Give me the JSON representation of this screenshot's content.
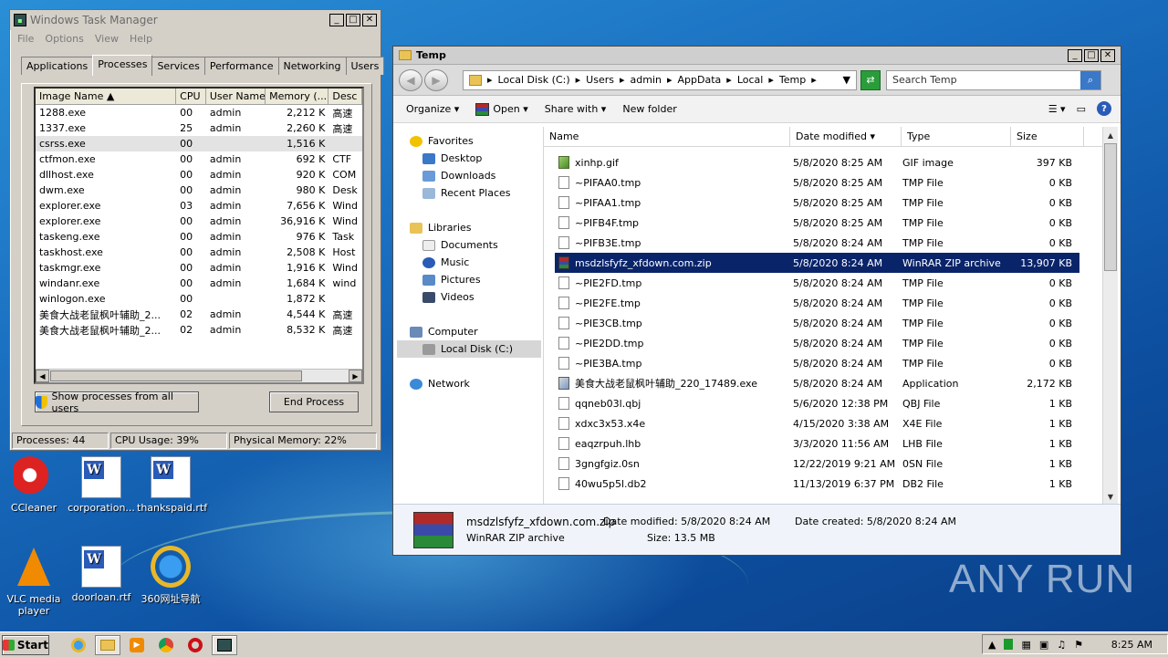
{
  "task_manager": {
    "title": "Windows Task Manager",
    "menu": [
      "File",
      "Options",
      "View",
      "Help"
    ],
    "tabs": [
      "Applications",
      "Processes",
      "Services",
      "Performance",
      "Networking",
      "Users"
    ],
    "active_tab": "Processes",
    "columns": [
      "Image Name",
      "CPU",
      "User Name",
      "Memory (...",
      "Desc"
    ],
    "processes": [
      {
        "name": "1288.exe",
        "cpu": "00",
        "user": "admin",
        "mem": "2,212 K",
        "desc": "高速"
      },
      {
        "name": "1337.exe",
        "cpu": "25",
        "user": "admin",
        "mem": "2,260 K",
        "desc": "高速"
      },
      {
        "name": "csrss.exe",
        "cpu": "00",
        "user": "",
        "mem": "1,516 K",
        "desc": ""
      },
      {
        "name": "ctfmon.exe",
        "cpu": "00",
        "user": "admin",
        "mem": "692 K",
        "desc": "CTF"
      },
      {
        "name": "dllhost.exe",
        "cpu": "00",
        "user": "admin",
        "mem": "920 K",
        "desc": "COM"
      },
      {
        "name": "dwm.exe",
        "cpu": "00",
        "user": "admin",
        "mem": "980 K",
        "desc": "Desk"
      },
      {
        "name": "explorer.exe",
        "cpu": "03",
        "user": "admin",
        "mem": "7,656 K",
        "desc": "Wind"
      },
      {
        "name": "explorer.exe",
        "cpu": "00",
        "user": "admin",
        "mem": "36,916 K",
        "desc": "Wind"
      },
      {
        "name": "taskeng.exe",
        "cpu": "00",
        "user": "admin",
        "mem": "976 K",
        "desc": "Task"
      },
      {
        "name": "taskhost.exe",
        "cpu": "00",
        "user": "admin",
        "mem": "2,508 K",
        "desc": "Host"
      },
      {
        "name": "taskmgr.exe",
        "cpu": "00",
        "user": "admin",
        "mem": "1,916 K",
        "desc": "Wind"
      },
      {
        "name": "windanr.exe",
        "cpu": "00",
        "user": "admin",
        "mem": "1,684 K",
        "desc": "wind"
      },
      {
        "name": "winlogon.exe",
        "cpu": "00",
        "user": "",
        "mem": "1,872 K",
        "desc": ""
      },
      {
        "name": "美食大战老鼠枫叶辅助_2...",
        "cpu": "02",
        "user": "admin",
        "mem": "4,544 K",
        "desc": "高速"
      },
      {
        "name": "美食大战老鼠枫叶辅助_2...",
        "cpu": "02",
        "user": "admin",
        "mem": "8,532 K",
        "desc": "高速"
      }
    ],
    "selected_process_index": 2,
    "show_all_label": "Show processes from all users",
    "end_process_label": "End Process",
    "status": {
      "processes": "Processes: 44",
      "cpu": "CPU Usage: 39%",
      "memory": "Physical Memory: 22%"
    }
  },
  "explorer": {
    "title": "Temp",
    "breadcrumb": [
      "Local Disk (C:)",
      "Users",
      "admin",
      "AppData",
      "Local",
      "Temp"
    ],
    "search_placeholder": "Search Temp",
    "toolbar": {
      "organize": "Organize",
      "open": "Open",
      "share_with": "Share with",
      "new_folder": "New folder"
    },
    "nav": {
      "favorites": "Favorites",
      "favorites_items": [
        "Desktop",
        "Downloads",
        "Recent Places"
      ],
      "libraries": "Libraries",
      "libraries_items": [
        "Documents",
        "Music",
        "Pictures",
        "Videos"
      ],
      "computer": "Computer",
      "computer_items": [
        "Local Disk (C:)"
      ],
      "network": "Network"
    },
    "columns": {
      "name": "Name",
      "date": "Date modified",
      "type": "Type",
      "size": "Size"
    },
    "files": [
      {
        "name": "xinhp.gif",
        "date": "5/8/2020 8:25 AM",
        "type": "GIF image",
        "size": "397 KB",
        "icon": "gif"
      },
      {
        "name": "~PIFAA0.tmp",
        "date": "5/8/2020 8:25 AM",
        "type": "TMP File",
        "size": "0 KB",
        "icon": "file"
      },
      {
        "name": "~PIFAA1.tmp",
        "date": "5/8/2020 8:25 AM",
        "type": "TMP File",
        "size": "0 KB",
        "icon": "file"
      },
      {
        "name": "~PIFB4F.tmp",
        "date": "5/8/2020 8:25 AM",
        "type": "TMP File",
        "size": "0 KB",
        "icon": "file"
      },
      {
        "name": "~PIFB3E.tmp",
        "date": "5/8/2020 8:24 AM",
        "type": "TMP File",
        "size": "0 KB",
        "icon": "file"
      },
      {
        "name": "msdzlsfyfz_xfdown.com.zip",
        "date": "5/8/2020 8:24 AM",
        "type": "WinRAR ZIP archive",
        "size": "13,907 KB",
        "icon": "zip"
      },
      {
        "name": "~PIE2FD.tmp",
        "date": "5/8/2020 8:24 AM",
        "type": "TMP File",
        "size": "0 KB",
        "icon": "file"
      },
      {
        "name": "~PIE2FE.tmp",
        "date": "5/8/2020 8:24 AM",
        "type": "TMP File",
        "size": "0 KB",
        "icon": "file"
      },
      {
        "name": "~PIE3CB.tmp",
        "date": "5/8/2020 8:24 AM",
        "type": "TMP File",
        "size": "0 KB",
        "icon": "file"
      },
      {
        "name": "~PIE2DD.tmp",
        "date": "5/8/2020 8:24 AM",
        "type": "TMP File",
        "size": "0 KB",
        "icon": "file"
      },
      {
        "name": "~PIE3BA.tmp",
        "date": "5/8/2020 8:24 AM",
        "type": "TMP File",
        "size": "0 KB",
        "icon": "file"
      },
      {
        "name": "美食大战老鼠枫叶辅助_220_17489.exe",
        "date": "5/8/2020 8:24 AM",
        "type": "Application",
        "size": "2,172 KB",
        "icon": "app"
      },
      {
        "name": "qqneb03l.qbj",
        "date": "5/6/2020 12:38 PM",
        "type": "QBJ File",
        "size": "1 KB",
        "icon": "file"
      },
      {
        "name": "xdxc3x53.x4e",
        "date": "4/15/2020 3:38 AM",
        "type": "X4E File",
        "size": "1 KB",
        "icon": "file"
      },
      {
        "name": "eaqzrpuh.lhb",
        "date": "3/3/2020 11:56 AM",
        "type": "LHB File",
        "size": "1 KB",
        "icon": "file"
      },
      {
        "name": "3gngfgiz.0sn",
        "date": "12/22/2019 9:21 AM",
        "type": "0SN File",
        "size": "1 KB",
        "icon": "file"
      },
      {
        "name": "40wu5p5l.db2",
        "date": "11/13/2019 6:37 PM",
        "type": "DB2 File",
        "size": "1 KB",
        "icon": "file"
      }
    ],
    "selected_file_index": 5,
    "details": {
      "name": "msdzlsfyfz_xfdown.com.zip",
      "type": "WinRAR ZIP archive",
      "date_modified": "Date modified: 5/8/2020 8:24 AM",
      "size": "Size: 13.5 MB",
      "date_created": "Date created: 5/8/2020 8:24 AM"
    }
  },
  "desktop": {
    "icons": [
      {
        "label": "CCleaner",
        "kind": "ccleaner"
      },
      {
        "label": "corporation...",
        "kind": "word"
      },
      {
        "label": "thankspaid.rtf",
        "kind": "word"
      },
      {
        "label": "VLC media player",
        "kind": "vlc"
      },
      {
        "label": "doorloan.rtf",
        "kind": "word"
      },
      {
        "label": "360网址导航",
        "kind": "ie"
      }
    ],
    "watermark": "ANY RUN"
  },
  "taskbar": {
    "start_label": "Start",
    "clock": "8:25 AM"
  }
}
